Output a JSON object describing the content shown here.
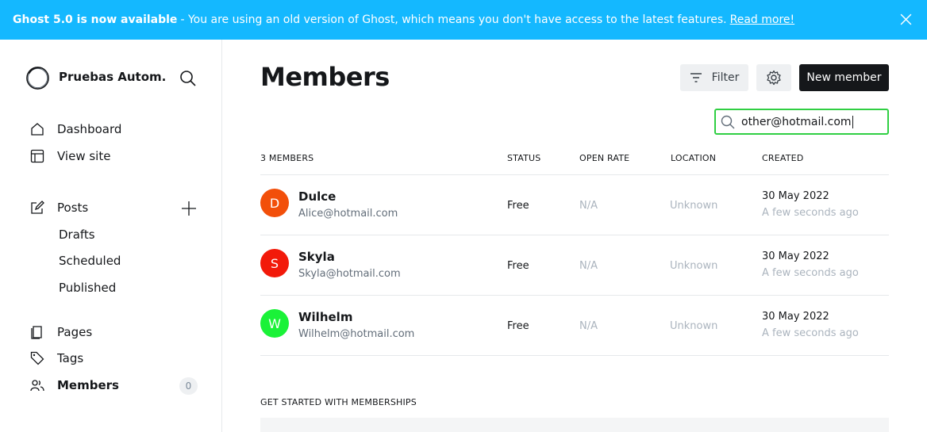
{
  "banner": {
    "title": "Ghost 5.0 is now available",
    "message": "- You are using an old version of Ghost, which means you don't have access to the latest features.",
    "link": "Read more!"
  },
  "sidebar": {
    "site_title": "Pruebas Autom...",
    "nav": {
      "dashboard": "Dashboard",
      "view_site": "View site",
      "posts": "Posts",
      "drafts": "Drafts",
      "scheduled": "Scheduled",
      "published": "Published",
      "pages": "Pages",
      "tags": "Tags",
      "members": "Members",
      "members_count": "0"
    }
  },
  "main": {
    "title": "Members",
    "filter_label": "Filter",
    "new_member_label": "New member",
    "search_value": "other@hotmail.com",
    "table": {
      "headers": {
        "members": "3 MEMBERS",
        "status": "STATUS",
        "open_rate": "OPEN RATE",
        "location": "LOCATION",
        "created": "CREATED"
      },
      "rows": [
        {
          "initial": "D",
          "name": "Dulce",
          "email": "Alice@hotmail.com",
          "status": "Free",
          "open_rate": "N/A",
          "location": "Unknown",
          "date": "30 May 2022",
          "ago": "A few seconds ago",
          "color": "#f24f0a"
        },
        {
          "initial": "S",
          "name": "Skyla",
          "email": "Skyla@hotmail.com",
          "status": "Free",
          "open_rate": "N/A",
          "location": "Unknown",
          "date": "30 May 2022",
          "ago": "A few seconds ago",
          "color": "#f21a0a"
        },
        {
          "initial": "W",
          "name": "Wilhelm",
          "email": "Wilhelm@hotmail.com",
          "status": "Free",
          "open_rate": "N/A",
          "location": "Unknown",
          "date": "30 May 2022",
          "ago": "A few seconds ago",
          "color": "#1af238"
        }
      ]
    },
    "section_title": "GET STARTED WITH MEMBERSHIPS"
  },
  "colors": {
    "banner": "#14b8ff",
    "search_border": "#30cf43",
    "primary_button": "#15171a"
  }
}
